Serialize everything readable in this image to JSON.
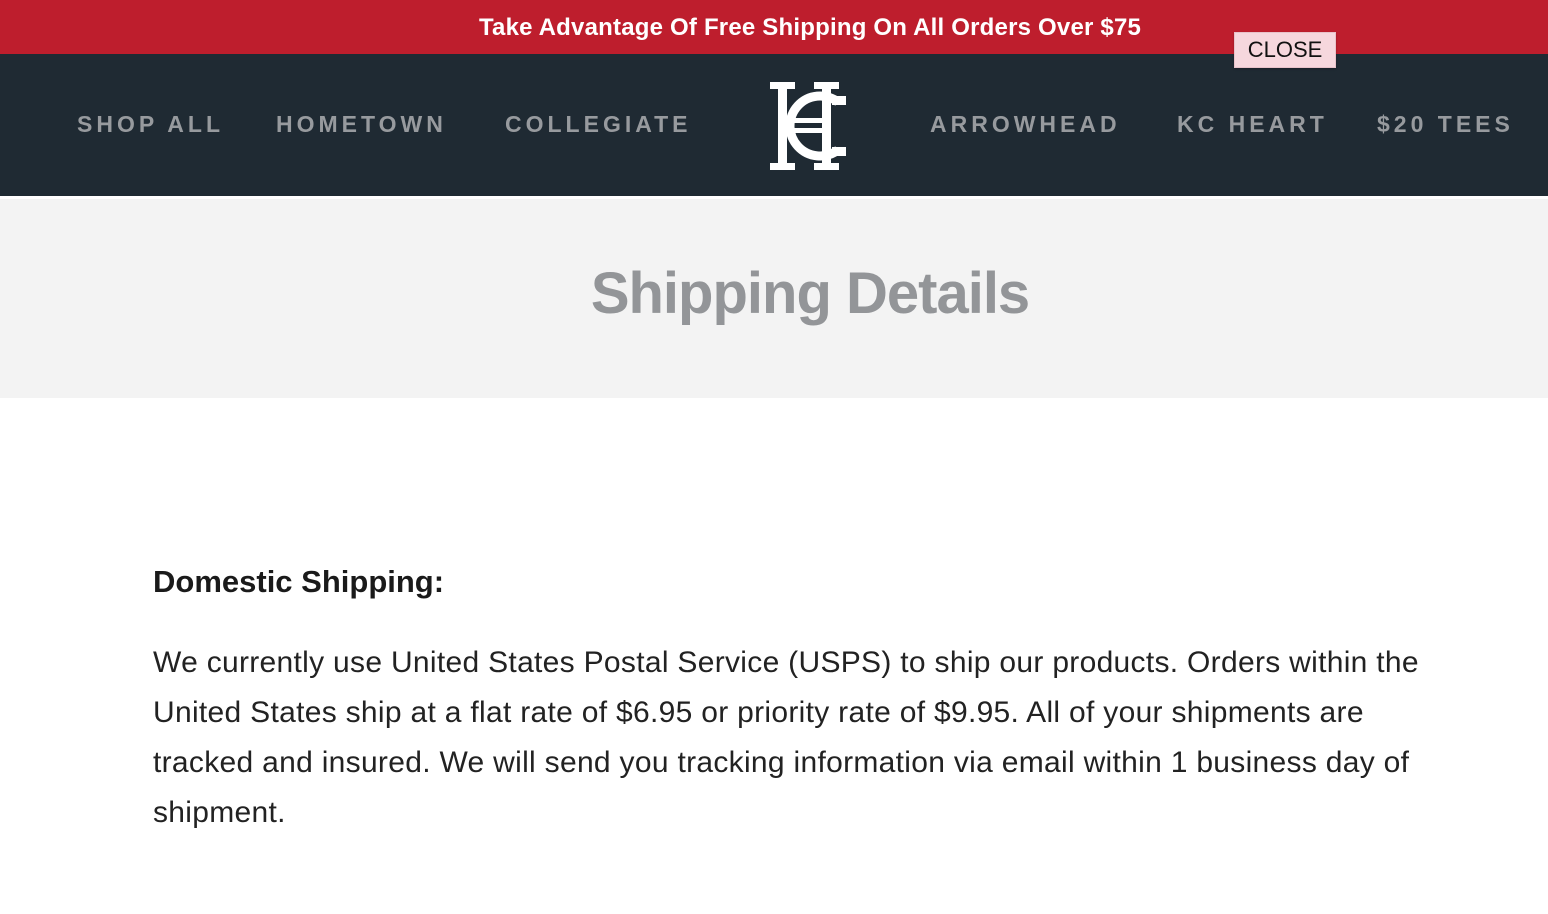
{
  "promo": {
    "text": "Take Advantage Of Free Shipping On All Orders Over $75",
    "close_label": "CLOSE"
  },
  "nav": {
    "items": [
      {
        "label": "SHOP ALL"
      },
      {
        "label": "HOMETOWN"
      },
      {
        "label": "COLLEGIATE"
      },
      {
        "label": "ARROWHEAD"
      },
      {
        "label": "KC HEART"
      },
      {
        "label": "$20 TEES"
      }
    ],
    "logo_icon": "hc-monogram-logo"
  },
  "page": {
    "title": "Shipping Details"
  },
  "content": {
    "heading": "Domestic Shipping:",
    "body": "We currently use United States Postal Service (USPS) to ship our products. Orders within the United States ship at a flat rate of $6.95 or priority rate of $9.95. All of your shipments are tracked and insured. We will send you tracking information via email within 1 business day of shipment."
  },
  "colors": {
    "promo_bg": "#be1e2d",
    "nav_bg": "#1f2a33",
    "nav_text": "#979a9e",
    "hero_bg": "#f3f3f3",
    "title_text": "#939598"
  }
}
